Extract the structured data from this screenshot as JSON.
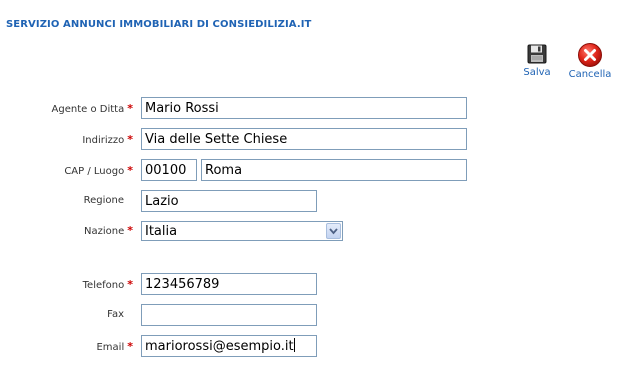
{
  "header": {
    "title": "SERVIZIO ANNUNCI IMMOBILIARI DI CONSIEDILIZIA.IT"
  },
  "toolbar": {
    "save_label": "Salva",
    "save_icon": "floppy-disk-icon",
    "cancel_label": "Cancella",
    "cancel_icon": "red-x-circle-icon"
  },
  "form": {
    "required_marker": "*",
    "agent": {
      "label": "Agente o Ditta",
      "value": "Mario Rossi"
    },
    "address": {
      "label": "Indirizzo",
      "value": "Via delle Sette Chiese"
    },
    "cap_place": {
      "label": "CAP / Luogo",
      "cap_value": "00100",
      "place_value": "Roma"
    },
    "region": {
      "label": "Regione",
      "value": "Lazio"
    },
    "country": {
      "label": "Nazione",
      "selected": "Italia"
    },
    "phone": {
      "label": "Telefono",
      "value": "123456789"
    },
    "fax": {
      "label": "Fax",
      "value": ""
    },
    "email": {
      "label": "Email",
      "value": "mariorossi@esempio.it"
    }
  },
  "colors": {
    "title_blue": "#1f63b4",
    "required_red": "#cc0000",
    "input_border": "#7f9db9"
  }
}
